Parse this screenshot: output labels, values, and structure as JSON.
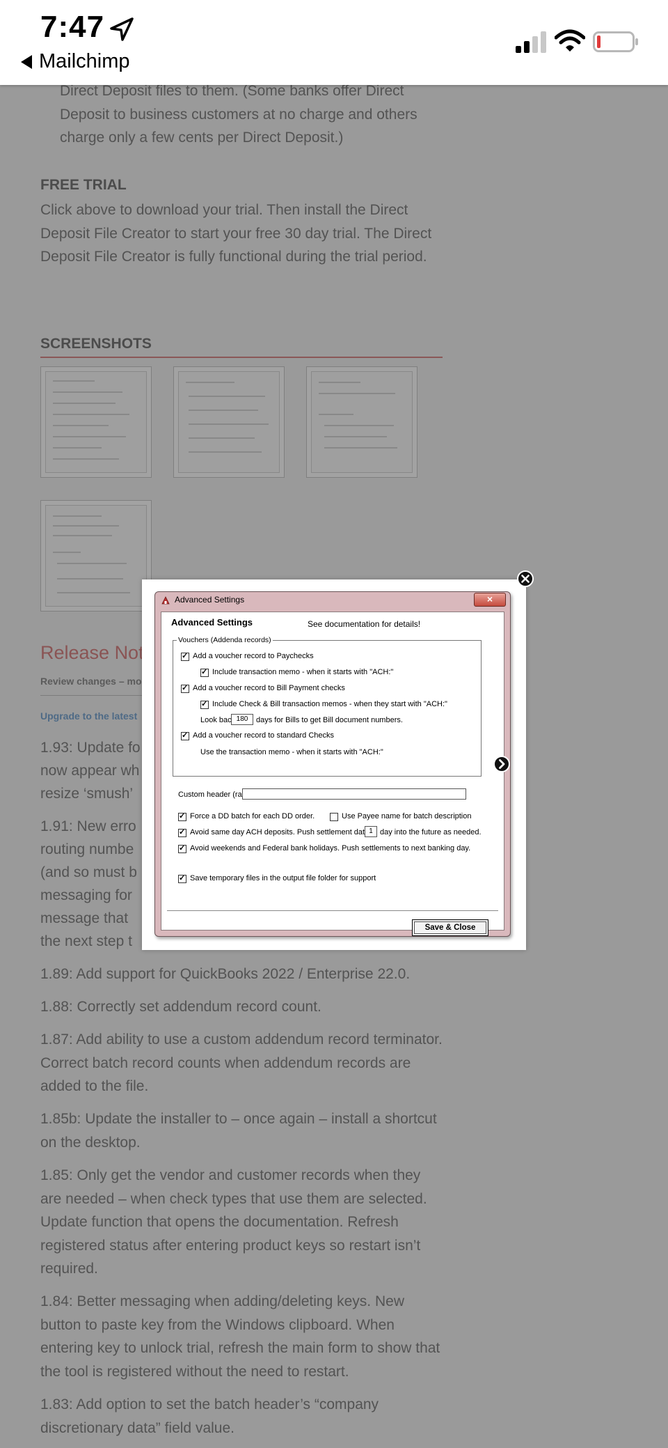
{
  "status_bar": {
    "time": "7:47",
    "back_app": "Mailchimp",
    "battery_color": "#e03a3a"
  },
  "article": {
    "intro_tail": "Direct Deposit files to them. (Some banks offer Direct Deposit to business customers at no charge and others charge only a few cents per Direct Deposit.)",
    "free_trial_heading": "FREE TRIAL",
    "free_trial_text": "Click above to download your trial.  Then install the Direct Deposit File Creator to start your free 30 day trial.  The Direct Deposit File Creator is fully functional during the trial period.",
    "screenshots_heading": "SCREENSHOTS",
    "release_notes_heading": "Release Note",
    "review_changes": "Review changes – mo",
    "upgrade_link": "Upgrade to the latest",
    "notes_partial": [
      "1.93: Update fo",
      "now appear wh",
      "resize ‘smush’",
      "1.91: New erro",
      "routing numbe",
      "(and so must b",
      "messaging for",
      "message that",
      "the next step t"
    ],
    "notes": [
      "1.89: Add support for QuickBooks 2022 / Enterprise 22.0.",
      "1.88: Correctly set addendum record count.",
      "1.87: Add ability to use a custom addendum record terminator. Correct batch record counts when addendum records are added to the file.",
      "1.85b: Update the installer to – once again – install a shortcut on the desktop.",
      "1.85: Only get the vendor and customer records when they are needed  – when check types that use them are selected. Update function that opens the documentation. Refresh registered status after entering product keys so restart isn’t required.",
      "1.84: Better messaging when adding/deleting keys. New button to paste key from the Windows clipboard. When entering key to unlock trial, refresh the main form to show that the tool is registered without the need to restart.",
      "1.83: Add option to set the batch header’s “company discretionary data” field value."
    ]
  },
  "dialog": {
    "window_title": "Advanced Settings",
    "close_glyph": "×",
    "heading": "Advanced Settings",
    "doc_note": "See documentation for details!",
    "group_title": "Vouchers (Addenda records)",
    "opt_paychecks": "Add a voucher record to Paychecks",
    "opt_paycheck_memo": "Include transaction memo - when it starts with \"ACH:\"",
    "opt_bill_payment": "Add a voucher record to Bill Payment checks",
    "opt_bill_memo": "Include Check & Bill transaction memos - when they start with \"ACH:\"",
    "lookback_label": "Look back",
    "lookback_value": "180",
    "lookback_suffix": "days for Bills to get Bill document numbers.",
    "opt_standard_checks": "Add a voucher record to standard Checks",
    "standard_memo_note": "Use the transaction memo - when it starts with \"ACH:\"",
    "custom_header_label": "Custom header (rare)",
    "custom_header_value": "",
    "opt_force_batch": "Force a DD batch for each DD order.",
    "opt_payee_name": "Use Payee name for batch description",
    "opt_avoid_sameday": "Avoid same day ACH deposits. Push settlement dates",
    "sameday_value": "1",
    "sameday_suffix": "day into the future as needed.",
    "opt_avoid_weekends": "Avoid weekends and Federal bank holidays. Push settlements to next banking day.",
    "opt_temp_files": "Save temporary files in the output file folder for support",
    "save_close": "Save & Close"
  }
}
